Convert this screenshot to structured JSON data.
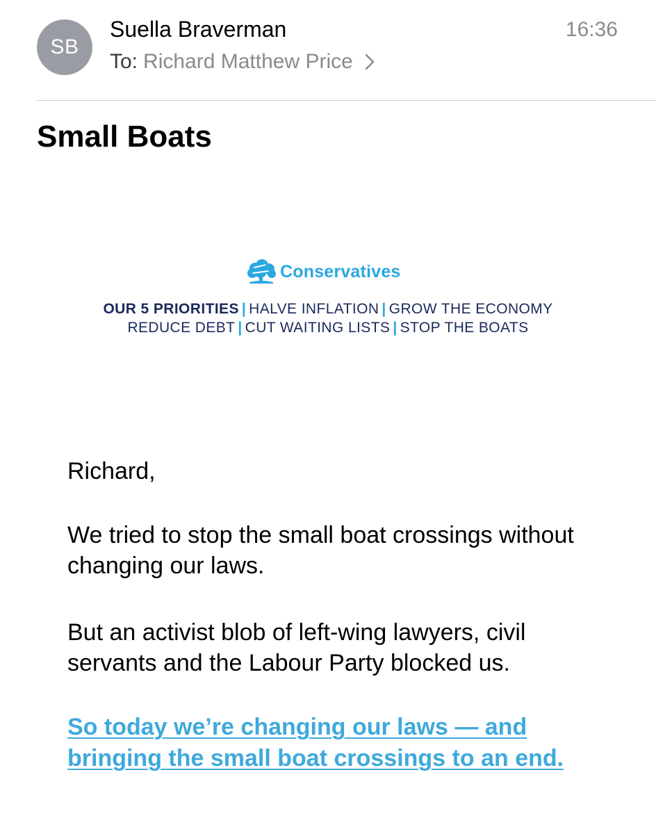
{
  "header": {
    "avatar_initials": "SB",
    "sender": "Suella Braverman",
    "time": "16:36",
    "to_label": "To:",
    "recipient": "Richard Matthew Price",
    "chevron_icon": "chevron-right-icon"
  },
  "subject": "Small Boats",
  "banner": {
    "brand": "Conservatives",
    "logo_icon": "oak-tree-icon",
    "priorities_label": "OUR 5 PRIORITIES",
    "separator": "|",
    "priority_1": "HALVE INFLATION",
    "priority_2": "GROW THE ECONOMY",
    "priority_3": "REDUCE DEBT",
    "priority_4": "CUT WAITING LISTS",
    "priority_5": "STOP THE BOATS"
  },
  "body": {
    "salutation": "Richard,",
    "paragraph_1": "We tried to stop the small boat crossings without changing our laws.",
    "paragraph_2": "But an activist blob of left-wing lawyers, civil servants and the Labour Party blocked us.",
    "link_text": "So today we’re changing our laws — and bringing the small boat crossings to an end."
  },
  "colors": {
    "brand_blue": "#2aa8e0",
    "navy": "#1b2a5c",
    "link_blue": "#3fa9dc",
    "avatar_gray": "#9a9ca3",
    "meta_gray": "#8a8a8e"
  }
}
